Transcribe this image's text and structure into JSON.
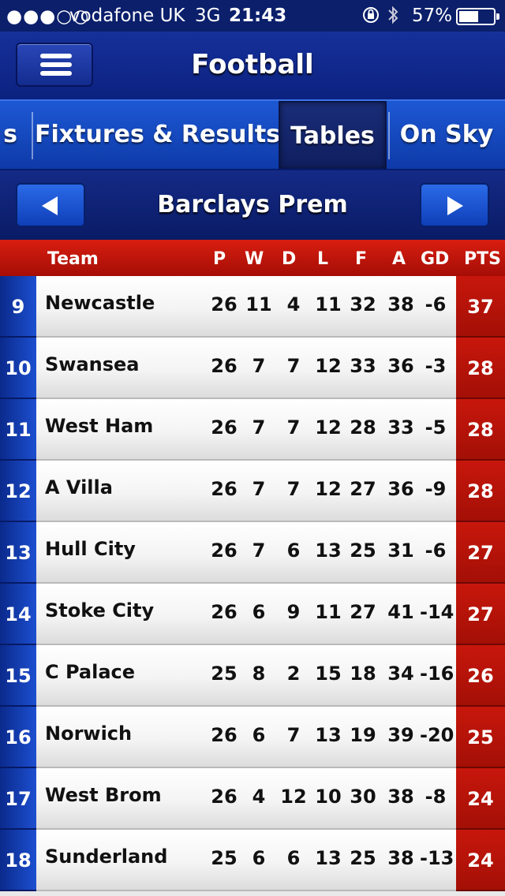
{
  "status_bar": {
    "signal": "●●●○○",
    "carrier": "vodafone UK",
    "network": "3G",
    "time": "21:43",
    "battery_percent": "57%",
    "battery_level": 0.57
  },
  "header": {
    "title": "Football"
  },
  "tabs": [
    {
      "label": "s",
      "active": false
    },
    {
      "label": "Fixtures & Results",
      "active": false
    },
    {
      "label": "Tables",
      "active": true
    },
    {
      "label": "On Sky",
      "active": false
    }
  ],
  "league": {
    "name": "Barclays Prem",
    "prev_icon": "left-triangle-icon",
    "next_icon": "right-triangle-icon"
  },
  "table": {
    "columns": [
      "Team",
      "P",
      "W",
      "D",
      "L",
      "F",
      "A",
      "GD",
      "PTS"
    ],
    "rows": [
      {
        "pos": "9",
        "team": "Newcastle",
        "p": "26",
        "w": "11",
        "d": "4",
        "l": "11",
        "f": "32",
        "a": "38",
        "gd": "-6",
        "pts": "37"
      },
      {
        "pos": "10",
        "team": "Swansea",
        "p": "26",
        "w": "7",
        "d": "7",
        "l": "12",
        "f": "33",
        "a": "36",
        "gd": "-3",
        "pts": "28"
      },
      {
        "pos": "11",
        "team": "West Ham",
        "p": "26",
        "w": "7",
        "d": "7",
        "l": "12",
        "f": "28",
        "a": "33",
        "gd": "-5",
        "pts": "28"
      },
      {
        "pos": "12",
        "team": "A Villa",
        "p": "26",
        "w": "7",
        "d": "7",
        "l": "12",
        "f": "27",
        "a": "36",
        "gd": "-9",
        "pts": "28"
      },
      {
        "pos": "13",
        "team": "Hull City",
        "p": "26",
        "w": "7",
        "d": "6",
        "l": "13",
        "f": "25",
        "a": "31",
        "gd": "-6",
        "pts": "27"
      },
      {
        "pos": "14",
        "team": "Stoke City",
        "p": "26",
        "w": "6",
        "d": "9",
        "l": "11",
        "f": "27",
        "a": "41",
        "gd": "-14",
        "pts": "27"
      },
      {
        "pos": "15",
        "team": "C Palace",
        "p": "25",
        "w": "8",
        "d": "2",
        "l": "15",
        "f": "18",
        "a": "34",
        "gd": "-16",
        "pts": "26"
      },
      {
        "pos": "16",
        "team": "Norwich",
        "p": "26",
        "w": "6",
        "d": "7",
        "l": "13",
        "f": "19",
        "a": "39",
        "gd": "-20",
        "pts": "25"
      },
      {
        "pos": "17",
        "team": "West Brom",
        "p": "26",
        "w": "4",
        "d": "12",
        "l": "10",
        "f": "30",
        "a": "38",
        "gd": "-8",
        "pts": "24"
      },
      {
        "pos": "18",
        "team": "Sunderland",
        "p": "25",
        "w": "6",
        "d": "6",
        "l": "13",
        "f": "25",
        "a": "38",
        "gd": "-13",
        "pts": "24"
      }
    ]
  },
  "colors": {
    "header_blue": "#0c2280",
    "tab_blue": "#1d58d4",
    "row_red": "#c8170c",
    "pos_blue": "#0a2a8c"
  }
}
